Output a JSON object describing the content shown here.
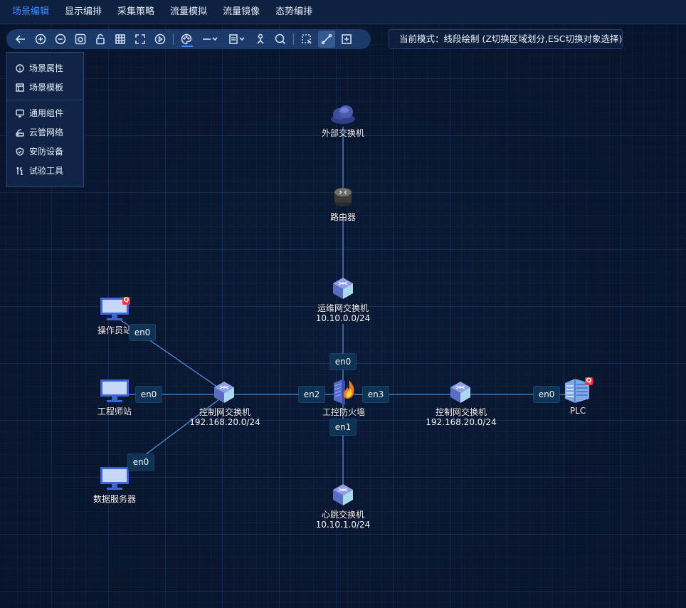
{
  "menu": {
    "items": [
      "场景编辑",
      "显示编排",
      "采集策略",
      "流量模拟",
      "流量镜像",
      "态势编排"
    ],
    "active_index": 0,
    "active_color": "#3a8cff"
  },
  "mode": {
    "text": "当前模式：线段绘制 (Z切换区域划分,ESC切换对象选择)"
  },
  "sidepanel": {
    "group1": [
      {
        "label": "场景属性",
        "icon": "info-icon"
      },
      {
        "label": "场景模板",
        "icon": "template-icon"
      }
    ],
    "group2": [
      {
        "label": "通用组件",
        "icon": "monitor-icon"
      },
      {
        "label": "云管网络",
        "icon": "router-icon"
      },
      {
        "label": "安防设备",
        "icon": "shield-icon"
      },
      {
        "label": "试验工具",
        "icon": "tools-icon"
      }
    ]
  },
  "nodes": {
    "external_switch": {
      "label": "外部交换机"
    },
    "router": {
      "label": "路由器"
    },
    "ops_switch": {
      "label": "运维网交换机",
      "subnet": "10.10.0.0/24"
    },
    "operator_station": {
      "label": "操作员站"
    },
    "engineer_station": {
      "label": "工程师站"
    },
    "data_server": {
      "label": "数据服务器"
    },
    "control_switch_left": {
      "label": "控制网交换机",
      "subnet": "192.168.20.0/24"
    },
    "firewall": {
      "label": "工控防火墙"
    },
    "control_switch_right": {
      "label": "控制网交换机",
      "subnet": "192.168.20.0/24"
    },
    "plc": {
      "label": "PLC"
    },
    "heartbeat_switch": {
      "label": "心跳交换机",
      "subnet": "10.10.1.0/24"
    }
  },
  "ports": {
    "operator_en0": "en0",
    "engineer_en0": "en0",
    "server_en0": "en0",
    "firewall_en0": "en0",
    "firewall_en1": "en1",
    "firewall_en2": "en2",
    "firewall_en3": "en3",
    "plc_en0": "en0"
  },
  "badges": {
    "operator": "Q",
    "plc": "Q"
  },
  "colors": {
    "link": "#4f8fd9",
    "alert_badge": "#e3383f",
    "background": "#0b1a36"
  }
}
